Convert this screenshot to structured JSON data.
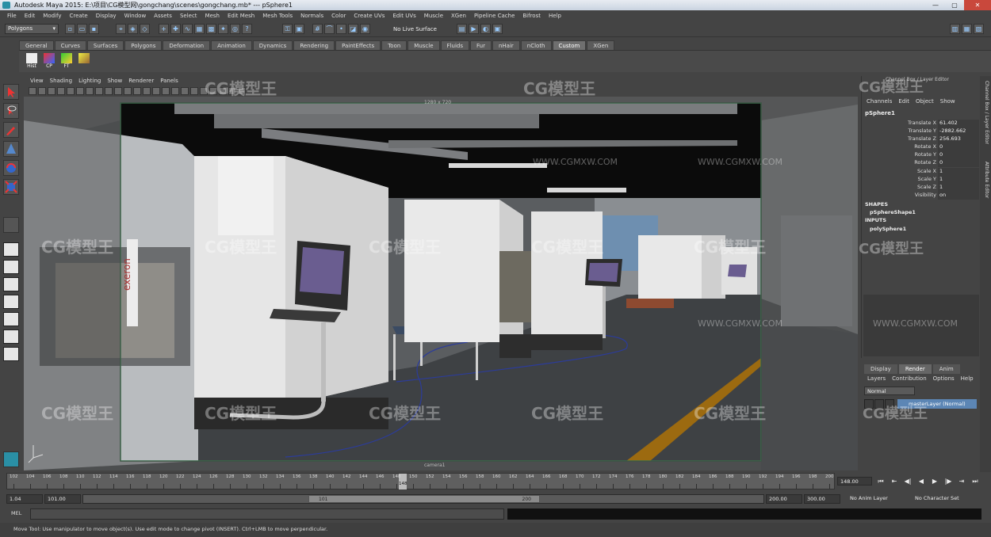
{
  "window": {
    "title": "Autodesk Maya 2015: E:\\项目\\CG模型网\\gongchang\\scenes\\gongchang.mb*   ---   pSphere1",
    "controls": [
      "—",
      "▢",
      "✕"
    ]
  },
  "menu": [
    "File",
    "Edit",
    "Modify",
    "Create",
    "Display",
    "Window",
    "Assets",
    "Select",
    "Mesh",
    "Edit Mesh",
    "Mesh Tools",
    "Normals",
    "Color",
    "Create UVs",
    "Edit UVs",
    "Muscle",
    "XGen",
    "Pipeline Cache",
    "Bifrost",
    "Help"
  ],
  "status_line": {
    "mode": "Polygons",
    "live_surface": "No Live Surface"
  },
  "shelf": {
    "tabs": [
      "General",
      "Curves",
      "Surfaces",
      "Polygons",
      "Deformation",
      "Animation",
      "Dynamics",
      "Rendering",
      "PaintEffects",
      "Toon",
      "Muscle",
      "Fluids",
      "Fur",
      "nHair",
      "nCloth",
      "Custom",
      "XGen"
    ],
    "active_tab": "Custom",
    "buttons": [
      "Hist",
      "CP",
      "FT",
      ""
    ]
  },
  "viewport": {
    "menu": [
      "View",
      "Shading",
      "Lighting",
      "Show",
      "Renderer",
      "Panels"
    ],
    "hud_top": "1280 x 720",
    "hud_bottom": "camera1",
    "bg_color": "#4c4c4c",
    "floor_color": "#3d4042"
  },
  "watermark": {
    "logo": "CG模型王",
    "url": "WWW.CGMXW.COM"
  },
  "channel_box": {
    "title": "Channel Box / Layer Editor",
    "menu": [
      "Channels",
      "Edit",
      "Object",
      "Show"
    ],
    "object": "pSphere1",
    "attributes": [
      {
        "label": "Translate X",
        "value": "61.402"
      },
      {
        "label": "Translate Y",
        "value": "-2882.662"
      },
      {
        "label": "Translate Z",
        "value": "256.693"
      },
      {
        "label": "Rotate X",
        "value": "0"
      },
      {
        "label": "Rotate Y",
        "value": "0"
      },
      {
        "label": "Rotate Z",
        "value": "0"
      },
      {
        "label": "Scale X",
        "value": "1"
      },
      {
        "label": "Scale Y",
        "value": "1"
      },
      {
        "label": "Scale Z",
        "value": "1"
      },
      {
        "label": "Visibility",
        "value": "on"
      }
    ],
    "shapes_header": "SHAPES",
    "shape": "pSphereShape1",
    "inputs_header": "INPUTS",
    "input": "polySphere1"
  },
  "side_tabs": [
    "Channel Box / Layer Editor",
    "Attribute Editor"
  ],
  "layer_editor": {
    "tabs": [
      "Display",
      "Render",
      "Anim"
    ],
    "active_tab": "Render",
    "menu": [
      "Layers",
      "Contribution",
      "Options",
      "Help"
    ],
    "blend_mode": "Normal",
    "layer_name": "masterLayer (Normal)"
  },
  "time_slider": {
    "ticks": [
      "102",
      "104",
      "106",
      "108",
      "110",
      "112",
      "114",
      "116",
      "118",
      "120",
      "122",
      "124",
      "126",
      "128",
      "130",
      "132",
      "134",
      "136",
      "138",
      "140",
      "142",
      "144",
      "146",
      "148",
      "150",
      "152",
      "154",
      "156",
      "158",
      "160",
      "162",
      "164",
      "166",
      "168",
      "170",
      "172",
      "174",
      "176",
      "178",
      "180",
      "182",
      "184",
      "186",
      "188",
      "190",
      "192",
      "194",
      "196",
      "198",
      "200"
    ],
    "current_frame": "148",
    "current_frame_field": "148.00",
    "playback": [
      "⏮",
      "⇤",
      "◀|",
      "◀",
      "▶",
      "|▶",
      "⇥",
      "⏭"
    ]
  },
  "range_slider": {
    "start_time": "1.04",
    "playback_start": "101.00",
    "handle_start": "101",
    "handle_end": "200",
    "playback_end": "200.00",
    "end_time": "300.00",
    "anim_layer": "No Anim Layer",
    "character_set": "No Character Set"
  },
  "command_line": {
    "label": "MEL"
  },
  "help_line": "Move Tool: Use manipulator to move object(s). Use edit mode to change pivot (INSERT). Ctrl+LMB to move perpendicular."
}
